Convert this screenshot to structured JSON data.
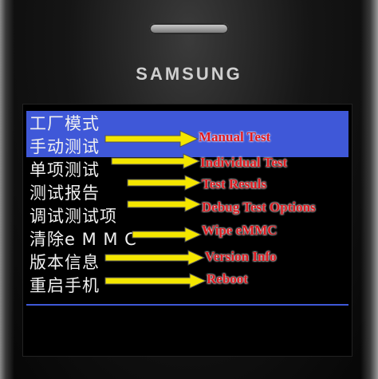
{
  "device": {
    "brand": "SAMSUNG"
  },
  "menu": {
    "items": [
      {
        "label": "工厂模式",
        "selected": false
      },
      {
        "label": "手动测试",
        "selected": true
      },
      {
        "label": "单项测试",
        "selected": false
      },
      {
        "label": "测试报告",
        "selected": false
      },
      {
        "label": "调试测试项",
        "selected": false
      },
      {
        "label": "清除e M M C",
        "selected": false
      },
      {
        "label": "版本信息",
        "selected": false
      },
      {
        "label": "重启手机",
        "selected": false
      }
    ],
    "highlight_color": "#3f58d8"
  },
  "annotations": {
    "color": "#e0191f",
    "arrow_color": "#f4e600",
    "labels": [
      "Manual Test",
      "Individual Test",
      "Test Resuls",
      "Debug Test Options",
      "Wipe eMMC",
      "Version Info",
      "Reboot"
    ]
  }
}
